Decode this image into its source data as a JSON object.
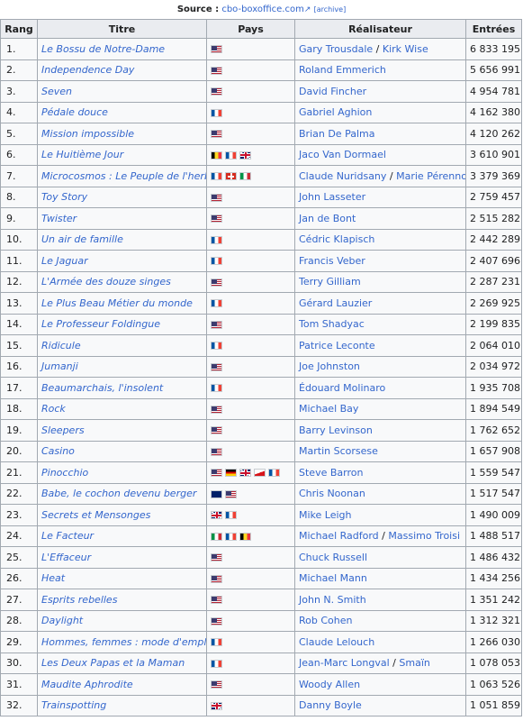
{
  "source": {
    "label": "Source :",
    "site": "cbo-boxoffice.com",
    "archive": "archive"
  },
  "headers": {
    "rank": "Rang",
    "title": "Titre",
    "country": "Pays",
    "director": "Réalisateur",
    "entries": "Entrées"
  },
  "rows": [
    {
      "rank": "1.",
      "title": "Le Bossu de Notre-Dame",
      "flags": [
        "us"
      ],
      "directors": [
        "Gary Trousdale",
        "Kirk Wise"
      ],
      "entries": "6 833 195"
    },
    {
      "rank": "2.",
      "title": "Independence Day",
      "flags": [
        "us"
      ],
      "directors": [
        "Roland Emmerich"
      ],
      "entries": "5 656 991"
    },
    {
      "rank": "3.",
      "title": "Seven",
      "flags": [
        "us"
      ],
      "directors": [
        "David Fincher"
      ],
      "entries": "4 954 781"
    },
    {
      "rank": "4.",
      "title": "Pédale douce",
      "flags": [
        "fr"
      ],
      "directors": [
        "Gabriel Aghion"
      ],
      "entries": "4 162 380"
    },
    {
      "rank": "5.",
      "title": "Mission impossible",
      "flags": [
        "us"
      ],
      "directors": [
        "Brian De Palma"
      ],
      "entries": "4 120 262"
    },
    {
      "rank": "6.",
      "title": "Le Huitième Jour",
      "flags": [
        "be",
        "fr",
        "gb"
      ],
      "directors": [
        "Jaco Van Dormael"
      ],
      "entries": "3 610 901"
    },
    {
      "rank": "7.",
      "title": "Microcosmos : Le Peuple de l'herbe",
      "flags": [
        "fr",
        "ch",
        "it"
      ],
      "directors": [
        "Claude Nuridsany",
        "Marie Pérennou"
      ],
      "entries": "3 379 369"
    },
    {
      "rank": "8.",
      "title": "Toy Story",
      "flags": [
        "us"
      ],
      "directors": [
        "John Lasseter"
      ],
      "entries": "2 759 457"
    },
    {
      "rank": "9.",
      "title": "Twister",
      "flags": [
        "us"
      ],
      "directors": [
        "Jan de Bont"
      ],
      "entries": "2 515 282"
    },
    {
      "rank": "10.",
      "title": "Un air de famille",
      "flags": [
        "fr"
      ],
      "directors": [
        "Cédric Klapisch"
      ],
      "entries": "2 442 289"
    },
    {
      "rank": "11.",
      "title": "Le Jaguar",
      "flags": [
        "fr"
      ],
      "directors": [
        "Francis Veber"
      ],
      "entries": "2 407 696"
    },
    {
      "rank": "12.",
      "title": "L'Armée des douze singes",
      "flags": [
        "us"
      ],
      "directors": [
        "Terry Gilliam"
      ],
      "entries": "2 287 231"
    },
    {
      "rank": "13.",
      "title": "Le Plus Beau Métier du monde",
      "flags": [
        "fr"
      ],
      "directors": [
        "Gérard Lauzier"
      ],
      "entries": "2 269 925"
    },
    {
      "rank": "14.",
      "title": "Le Professeur Foldingue",
      "flags": [
        "us"
      ],
      "directors": [
        "Tom Shadyac"
      ],
      "entries": "2 199 835"
    },
    {
      "rank": "15.",
      "title": "Ridicule",
      "flags": [
        "fr"
      ],
      "directors": [
        "Patrice Leconte"
      ],
      "entries": "2 064 010"
    },
    {
      "rank": "16.",
      "title": "Jumanji",
      "flags": [
        "us"
      ],
      "directors": [
        "Joe Johnston"
      ],
      "entries": "2 034 972"
    },
    {
      "rank": "17.",
      "title": "Beaumarchais, l'insolent",
      "flags": [
        "fr"
      ],
      "directors": [
        "Édouard Molinaro"
      ],
      "entries": "1 935 708"
    },
    {
      "rank": "18.",
      "title": "Rock",
      "flags": [
        "us"
      ],
      "directors": [
        "Michael Bay"
      ],
      "entries": "1 894 549"
    },
    {
      "rank": "19.",
      "title": "Sleepers",
      "flags": [
        "us"
      ],
      "directors": [
        "Barry Levinson"
      ],
      "entries": "1 762 652"
    },
    {
      "rank": "20.",
      "title": "Casino",
      "flags": [
        "us"
      ],
      "directors": [
        "Martin Scorsese"
      ],
      "entries": "1 657 908"
    },
    {
      "rank": "21.",
      "title": "Pinocchio",
      "flags": [
        "us",
        "de",
        "gb",
        "cz",
        "fr"
      ],
      "directors": [
        "Steve Barron"
      ],
      "entries": "1 559 547"
    },
    {
      "rank": "22.",
      "title": "Babe, le cochon devenu berger",
      "flags": [
        "au",
        "us"
      ],
      "directors": [
        "Chris Noonan"
      ],
      "entries": "1 517 547"
    },
    {
      "rank": "23.",
      "title": "Secrets et Mensonges",
      "flags": [
        "gb",
        "fr"
      ],
      "directors": [
        "Mike Leigh"
      ],
      "entries": "1 490 009"
    },
    {
      "rank": "24.",
      "title": "Le Facteur",
      "flags": [
        "it",
        "fr",
        "be"
      ],
      "directors": [
        "Michael Radford",
        "Massimo Troisi"
      ],
      "entries": "1 488 517"
    },
    {
      "rank": "25.",
      "title": "L'Effaceur",
      "flags": [
        "us"
      ],
      "directors": [
        "Chuck Russell"
      ],
      "entries": "1 486 432"
    },
    {
      "rank": "26.",
      "title": "Heat",
      "flags": [
        "us"
      ],
      "directors": [
        "Michael Mann"
      ],
      "entries": "1 434 256"
    },
    {
      "rank": "27.",
      "title": "Esprits rebelles",
      "flags": [
        "us"
      ],
      "directors": [
        "John N. Smith"
      ],
      "entries": "1 351 242"
    },
    {
      "rank": "28.",
      "title": "Daylight",
      "flags": [
        "us"
      ],
      "directors": [
        "Rob Cohen"
      ],
      "entries": "1 312 321"
    },
    {
      "rank": "29.",
      "title": "Hommes, femmes : mode d'emploi",
      "flags": [
        "fr"
      ],
      "directors": [
        "Claude Lelouch"
      ],
      "entries": "1 266 030"
    },
    {
      "rank": "30.",
      "title": "Les Deux Papas et la Maman",
      "flags": [
        "fr"
      ],
      "directors": [
        "Jean-Marc Longval",
        "Smaïn"
      ],
      "entries": "1 078 053"
    },
    {
      "rank": "31.",
      "title": "Maudite Aphrodite",
      "flags": [
        "us"
      ],
      "directors": [
        "Woody Allen"
      ],
      "entries": "1 063 526"
    },
    {
      "rank": "32.",
      "title": "Trainspotting",
      "flags": [
        "gb"
      ],
      "directors": [
        "Danny Boyle"
      ],
      "entries": "1 051 859"
    }
  ]
}
